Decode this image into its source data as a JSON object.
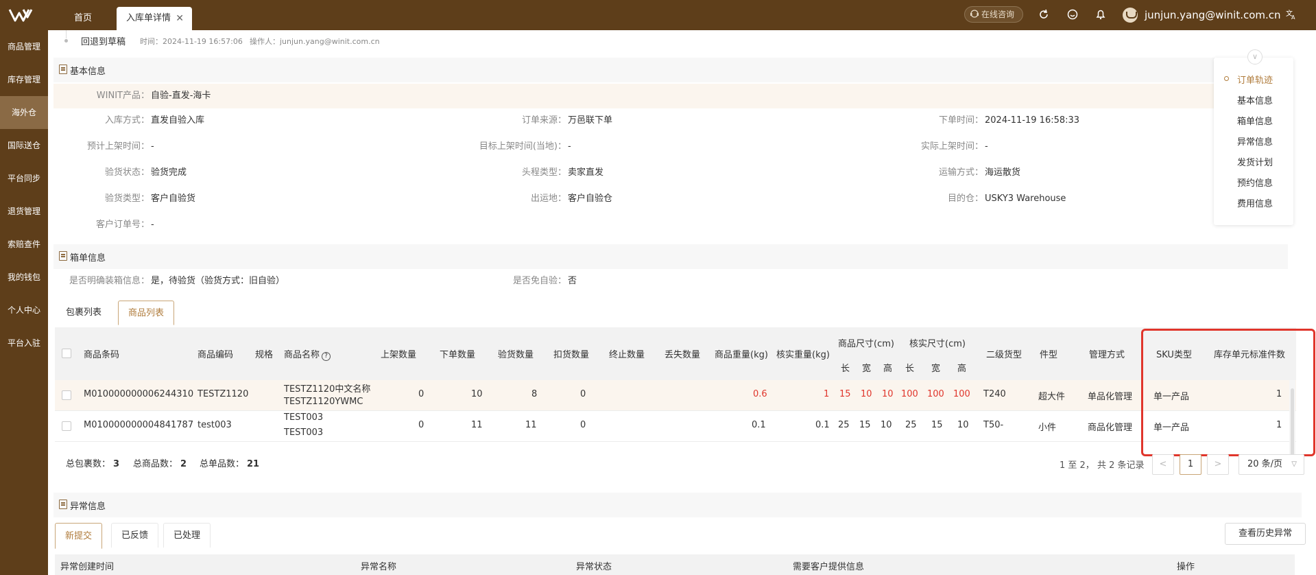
{
  "topbar": {
    "tabs": [
      "首页",
      "入库单详情"
    ],
    "consult": "在线咨询",
    "user": "junjun.yang@winit.com.cn"
  },
  "sidebar": {
    "items": [
      "商品管理",
      "库存管理",
      "海外仓",
      "国际送仓",
      "平台同步",
      "退货管理",
      "索赔查件",
      "我的钱包",
      "个人中心",
      "平台入驻"
    ]
  },
  "timeline": {
    "title": "回退到草稿",
    "time": "时间：2024-11-19 16:57:06",
    "operator": "操作人：junjun.yang@winit.com.cn"
  },
  "basic": {
    "title": "基本信息",
    "winit_label": "WINIT产品：",
    "winit_value": "自验-直发-海卡",
    "fields": [
      {
        "label": "入库方式：",
        "value": "直发自验入库"
      },
      {
        "label": "订单来源：",
        "value": "万邑联下单"
      },
      {
        "label": "下单时间：",
        "value": "2024-11-19 16:58:33"
      },
      {
        "label": "预计上架时间：",
        "value": "-"
      },
      {
        "label": "目标上架时间(当地)：",
        "value": "-"
      },
      {
        "label": "实际上架时间：",
        "value": "-"
      },
      {
        "label": "验货状态：",
        "value": "验货完成"
      },
      {
        "label": "头程类型：",
        "value": "卖家直发"
      },
      {
        "label": "运输方式：",
        "value": "海运散货"
      },
      {
        "label": "验货类型：",
        "value": "客户自验货"
      },
      {
        "label": "出运地：",
        "value": "客户自验仓"
      },
      {
        "label": "目的仓：",
        "value": "USKY3 Warehouse"
      },
      {
        "label": "客户订单号：",
        "value": "-"
      }
    ]
  },
  "box": {
    "title": "箱单信息",
    "fields": [
      {
        "label": "是否明确装箱信息：",
        "value": "是，待验货（验货方式：旧自验）"
      },
      {
        "label": "是否免自验：",
        "value": "否"
      }
    ],
    "tabs": [
      "包裹列表",
      "商品列表"
    ]
  },
  "goods": {
    "headers": [
      "商品条码",
      "商品编码",
      "规格",
      "商品名称",
      "上架数量",
      "下单数量",
      "验货数量",
      "扣货数量",
      "终止数量",
      "丢失数量",
      "商品重量(kg)",
      "核实重量(kg)",
      "商品尺寸(cm)",
      "核实尺寸(cm)",
      "长",
      "宽",
      "高",
      "长",
      "宽",
      "高",
      "二级货型",
      "件型",
      "管理方式",
      "SKU类型",
      "库存单元标准件数"
    ],
    "rows": [
      {
        "barcode": "M010000000006244310",
        "code": "TESTZ1120",
        "spec": "",
        "name1": "TESTZ1120中文名称",
        "name2": "TESTZ1120YWMC",
        "shelf": "0",
        "order": "10",
        "inspect": "8",
        "deduct": "0",
        "stop": "",
        "lost": "",
        "weight": "0.6",
        "vweight": "1",
        "l": "15",
        "w": "10",
        "h": "10",
        "vl": "100",
        "vw": "100",
        "vh": "100",
        "type2": "T240",
        "piece": "超大件",
        "manage": "单品化管理",
        "sku": "单一产品",
        "std": "1"
      },
      {
        "barcode": "M010000000004841787",
        "code": "test003",
        "spec": "",
        "name1": "TEST003",
        "name2": "TEST003",
        "shelf": "0",
        "order": "11",
        "inspect": "11",
        "deduct": "0",
        "stop": "",
        "lost": "",
        "weight": "0.1",
        "vweight": "0.1",
        "l": "25",
        "w": "15",
        "h": "10",
        "vl": "25",
        "vw": "15",
        "vh": "10",
        "type2": "T50-",
        "piece": "小件",
        "manage": "商品化管理",
        "sku": "单一产品",
        "std": "1"
      }
    ],
    "totals": [
      {
        "label": "总包裹数：",
        "value": "3"
      },
      {
        "label": "总商品数：",
        "value": "2"
      },
      {
        "label": "总单品数：",
        "value": "21"
      }
    ],
    "pager": {
      "info": "1 至 2，  共 2 条记录",
      "prev": "<",
      "page": "1",
      "next": ">",
      "size": "20 条/页"
    }
  },
  "anomaly": {
    "title": "异常信息",
    "tabs": [
      "新提交",
      "已反馈",
      "已处理"
    ],
    "history_button": "查看历史异常",
    "headers": [
      "异常创建时间",
      "异常名称",
      "异常状态",
      "需要客户提供信息",
      "操作"
    ]
  },
  "rightnav": {
    "items": [
      "订单轨迹",
      "基本信息",
      "箱单信息",
      "异常信息",
      "发货计划",
      "预约信息",
      "费用信息"
    ]
  },
  "colors": {
    "brand": "#5e3e1a",
    "accent": "#b07c3c",
    "alert": "#e0352b"
  }
}
